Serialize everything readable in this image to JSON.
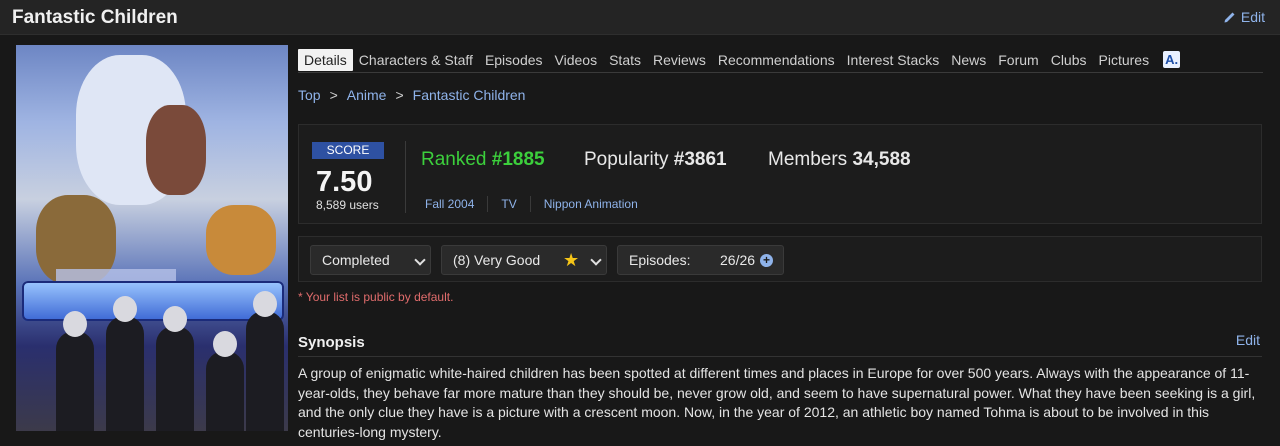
{
  "header": {
    "title": "Fantastic Children",
    "edit_label": "Edit"
  },
  "tabs": [
    "Details",
    "Characters & Staff",
    "Episodes",
    "Videos",
    "Stats",
    "Reviews",
    "Recommendations",
    "Interest Stacks",
    "News",
    "Forum",
    "Clubs",
    "Pictures"
  ],
  "tab_logo": "A.",
  "breadcrumb": {
    "items": [
      "Top",
      "Anime",
      "Fantastic Children"
    ],
    "separator": ">"
  },
  "score": {
    "label": "SCORE",
    "value": "7.50",
    "users": "8,589 users",
    "ranked_label": "Ranked",
    "ranked_value": "#1885",
    "popularity_label": "Popularity",
    "popularity_value": "#3861",
    "members_label": "Members",
    "members_value": "34,588",
    "season": "Fall 2004",
    "type": "TV",
    "studio": "Nippon Animation"
  },
  "list": {
    "status": "Completed",
    "rating": "(8) Very Good",
    "episodes_label": "Episodes:",
    "episodes_value": "26/26",
    "public_note": "* Your list is public by default."
  },
  "synopsis": {
    "heading": "Synopsis",
    "edit_label": "Edit",
    "text": "A group of enigmatic white-haired children has been spotted at different times and places in Europe for over 500 years. Always with the appearance of 11-year-olds, they behave far more mature than they should be, never grow old, and seem to have supernatural power. What they have been seeking is a girl, and the only clue they have is a picture with a crescent moon. Now, in the year of 2012, an athletic boy named Tohma is about to be involved in this centuries-long mystery."
  },
  "colors": {
    "accent": "#8fb3ea",
    "ranked": "#3ccf3c",
    "score_badge": "#2e51a2",
    "warning": "#e06c6c",
    "star": "#f5c518"
  },
  "icons": {
    "edit": "pencil-icon",
    "star": "star-icon",
    "plus": "plus-circle-icon",
    "chevron": "chevron-down-icon"
  }
}
